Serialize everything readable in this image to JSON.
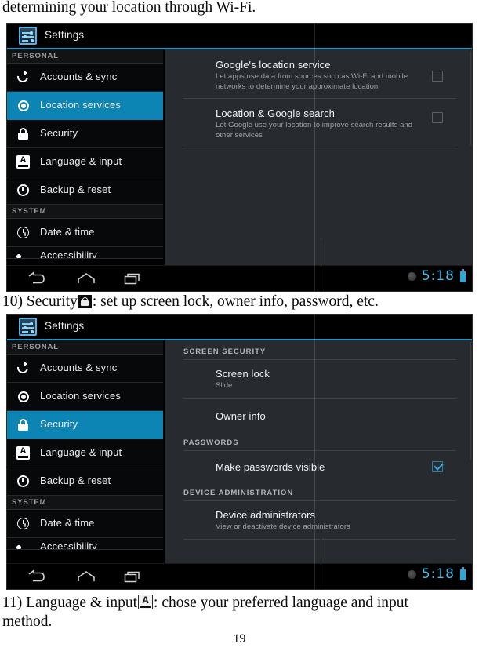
{
  "document": {
    "top_line": "determining your location through Wi-Fi.",
    "caption_10_prefix": "10) Security",
    "caption_10_suffix": ": set up screen lock, owner info, password, etc.",
    "caption_11_prefix": "11) Language & input",
    "caption_11_suffix": ": chose your preferred language and input",
    "caption_11_line2": "method.",
    "page_number": "19"
  },
  "colors": {
    "accent_blue": "#0c84b4",
    "rule_blue": "#2196c4",
    "status_blue": "#3fbde8",
    "content_bg": "#272a2e",
    "sidebar_bg": "#070809"
  },
  "screenshot_location": {
    "actionbar": {
      "title": "Settings",
      "icon": "settings-sliders-icon"
    },
    "sidebar": {
      "sections": [
        {
          "label": "PERSONAL",
          "items": [
            {
              "label": "Accounts & sync",
              "icon": "sync-icon",
              "selected": false
            },
            {
              "label": "Location services",
              "icon": "location-target-icon",
              "selected": true
            },
            {
              "label": "Security",
              "icon": "lock-icon",
              "selected": false
            },
            {
              "label": "Language & input",
              "icon": "keyboard-a-icon",
              "selected": false
            },
            {
              "label": "Backup & reset",
              "icon": "backup-restore-icon",
              "selected": false
            }
          ]
        },
        {
          "label": "SYSTEM",
          "items": [
            {
              "label": "Date & time",
              "icon": "clock-icon",
              "selected": false
            },
            {
              "label": "Accessibility",
              "icon": "accessibility-hand-icon",
              "selected": false
            }
          ]
        }
      ]
    },
    "content": {
      "rows": [
        {
          "title": "Google's location service",
          "subtitle": "Let apps use data from sources such as Wi-Fi and mobile networks to determine your approximate location",
          "checkbox": "unchecked"
        },
        {
          "title": "Location & Google search",
          "subtitle": "Let Google use your location to improve search results and other services",
          "checkbox": "unchecked"
        }
      ]
    },
    "navbar": {
      "back": "back-icon",
      "home": "home-icon",
      "recents": "recent-apps-icon",
      "status_icon": "notification-dot-icon",
      "time": "5:18",
      "battery": "battery-full-icon"
    }
  },
  "screenshot_security": {
    "actionbar": {
      "title": "Settings",
      "icon": "settings-sliders-icon"
    },
    "sidebar": {
      "sections": [
        {
          "label": "PERSONAL",
          "items": [
            {
              "label": "Accounts & sync",
              "icon": "sync-icon",
              "selected": false
            },
            {
              "label": "Location services",
              "icon": "location-target-icon",
              "selected": false
            },
            {
              "label": "Security",
              "icon": "lock-icon",
              "selected": true
            },
            {
              "label": "Language & input",
              "icon": "keyboard-a-icon",
              "selected": false
            },
            {
              "label": "Backup & reset",
              "icon": "backup-restore-icon",
              "selected": false
            }
          ]
        },
        {
          "label": "SYSTEM",
          "items": [
            {
              "label": "Date & time",
              "icon": "clock-icon",
              "selected": false
            },
            {
              "label": "Accessibility",
              "icon": "accessibility-hand-icon",
              "selected": false
            }
          ]
        }
      ]
    },
    "content": {
      "groups": [
        {
          "header": "SCREEN SECURITY",
          "rows": [
            {
              "title": "Screen lock",
              "subtitle": "Slide",
              "checkbox": null
            },
            {
              "title": "Owner info",
              "subtitle": "",
              "checkbox": null
            }
          ]
        },
        {
          "header": "PASSWORDS",
          "rows": [
            {
              "title": "Make passwords visible",
              "subtitle": "",
              "checkbox": "checked"
            }
          ]
        },
        {
          "header": "DEVICE ADMINISTRATION",
          "rows": [
            {
              "title": "Device administrators",
              "subtitle": "View or deactivate device administrators",
              "checkbox": null
            }
          ]
        }
      ]
    },
    "navbar": {
      "back": "back-icon",
      "home": "home-icon",
      "recents": "recent-apps-icon",
      "status_icon": "notification-dot-icon",
      "time": "5:18",
      "battery": "battery-full-icon"
    }
  }
}
